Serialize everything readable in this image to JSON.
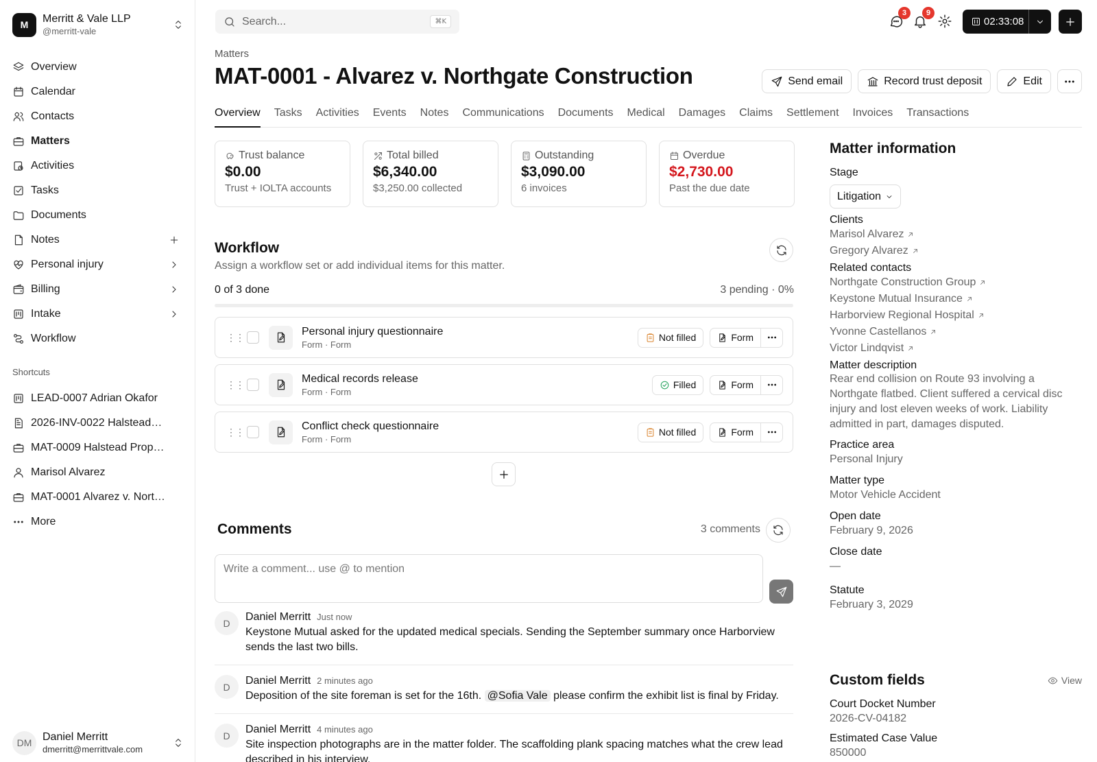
{
  "org": {
    "initial": "M",
    "name": "Merritt & Vale LLP",
    "handle": "@merritt-vale"
  },
  "nav": [
    {
      "label": "Overview",
      "icon": "layers-icon"
    },
    {
      "label": "Calendar",
      "icon": "calendar-icon"
    },
    {
      "label": "Contacts",
      "icon": "users-icon"
    },
    {
      "label": "Matters",
      "icon": "briefcase-icon",
      "active": true
    },
    {
      "label": "Activities",
      "icon": "activity-icon"
    },
    {
      "label": "Tasks",
      "icon": "task-icon"
    },
    {
      "label": "Documents",
      "icon": "folder-icon"
    },
    {
      "label": "Notes",
      "icon": "note-icon",
      "trailing": "plus-icon"
    },
    {
      "label": "Personal injury",
      "icon": "heart-pulse-icon",
      "trailing": "chevron-right-icon"
    },
    {
      "label": "Billing",
      "icon": "wallet-icon",
      "trailing": "chevron-right-icon"
    },
    {
      "label": "Intake",
      "icon": "intake-icon",
      "trailing": "chevron-right-icon"
    },
    {
      "label": "Workflow",
      "icon": "workflow-icon"
    }
  ],
  "shortcuts_title": "Shortcuts",
  "shortcuts": [
    {
      "label": "LEAD-0007 Adrian Okafor",
      "icon": "intake-icon"
    },
    {
      "label": "2026-INV-0022 Halstead…",
      "icon": "invoice-icon"
    },
    {
      "label": "MAT-0009 Halstead Prop…",
      "icon": "briefcase-icon"
    },
    {
      "label": "Marisol Alvarez",
      "icon": "user-icon"
    },
    {
      "label": "MAT-0001 Alvarez v. Nort…",
      "icon": "briefcase-icon"
    },
    {
      "label": "More",
      "icon": "more-icon"
    }
  ],
  "user": {
    "initials": "DM",
    "name": "Daniel Merritt",
    "email": "dmerritt@merrittvale.com"
  },
  "search": {
    "placeholder": "Search...",
    "shortcut": "⌘K"
  },
  "topbar": {
    "messages_count": "3",
    "notifications_count": "9",
    "timer": "02:33:08"
  },
  "header": {
    "breadcrumb": "Matters",
    "title": "MAT-0001 - Alvarez v. Northgate Construction",
    "send_email": "Send email",
    "record_deposit": "Record trust deposit",
    "edit": "Edit"
  },
  "tabs": [
    "Overview",
    "Tasks",
    "Activities",
    "Events",
    "Notes",
    "Communications",
    "Documents",
    "Medical",
    "Damages",
    "Claims",
    "Settlement",
    "Invoices",
    "Transactions"
  ],
  "stats": [
    {
      "label": "Trust balance",
      "value": "$0.00",
      "sub": "Trust + IOLTA accounts",
      "icon": "piggy-bank-icon"
    },
    {
      "label": "Total billed",
      "value": "$6,340.00",
      "sub": "$3,250.00 collected",
      "icon": "receipt-icon"
    },
    {
      "label": "Outstanding",
      "value": "$3,090.00",
      "sub": "6 invoices",
      "icon": "calculator-icon"
    },
    {
      "label": "Overdue",
      "value": "$2,730.00",
      "sub": "Past the due date",
      "icon": "calendar-alert-icon",
      "alert": true
    }
  ],
  "colors": {
    "overdue": "#d4161c",
    "badge": "#e5372d"
  },
  "workflow": {
    "title": "Workflow",
    "subtitle": "Assign a workflow set or add individual items for this matter.",
    "done": "0 of 3 done",
    "pending": "3 pending · 0%",
    "progress": 0,
    "items": [
      {
        "name": "Personal injury questionnaire",
        "meta": "Form · Form",
        "status": "Not filled",
        "filled": false,
        "action": "Form"
      },
      {
        "name": "Medical records release",
        "meta": "Form · Form",
        "status": "Filled",
        "filled": true,
        "action": "Form"
      },
      {
        "name": "Conflict check questionnaire",
        "meta": "Form · Form",
        "status": "Not filled",
        "filled": false,
        "action": "Form"
      }
    ]
  },
  "comments": {
    "title": "Comments",
    "count": "3 comments",
    "placeholder": "Write a comment... use @ to mention",
    "items": [
      {
        "initial": "D",
        "author": "Daniel Merritt",
        "time": "Just now",
        "text": "Keystone Mutual asked for the updated medical specials. Sending the September summary once Harborview sends the last two bills."
      },
      {
        "initial": "D",
        "author": "Daniel Merritt",
        "time": "2 minutes ago",
        "text_before": "Deposition of the site foreman is set for the 16th.",
        "mention": "@Sofia Vale",
        "text_after": "please confirm the exhibit list is final by Friday."
      },
      {
        "initial": "D",
        "author": "Daniel Merritt",
        "time": "4 minutes ago",
        "text": "Site inspection photographs are in the matter folder. The scaffolding plank spacing matches what the crew lead described in his interview."
      }
    ]
  },
  "info": {
    "title": "Matter information",
    "stage_label": "Stage",
    "stage": "Litigation",
    "clients_label": "Clients",
    "clients": [
      "Marisol Alvarez",
      "Gregory Alvarez"
    ],
    "related_label": "Related contacts",
    "related": [
      "Northgate Construction Group",
      "Keystone Mutual Insurance",
      "Harborview Regional Hospital",
      "Yvonne Castellanos",
      "Victor Lindqvist"
    ],
    "description_label": "Matter description",
    "description": "Rear end collision on Route 93 involving a Northgate flatbed. Client suffered a cervical disc injury and lost eleven weeks of work. Liability admitted in part, damages disputed.",
    "practice_label": "Practice area",
    "practice": "Personal Injury",
    "type_label": "Matter type",
    "type": "Motor Vehicle Accident",
    "open_label": "Open date",
    "open": "February 9, 2026",
    "close_label": "Close date",
    "close": "—",
    "statute_label": "Statute",
    "statute": "February 3, 2029"
  },
  "custom_fields": {
    "title": "Custom fields",
    "view": "View",
    "items": [
      {
        "label": "Court Docket Number",
        "value": "2026-CV-04182"
      },
      {
        "label": "Estimated Case Value",
        "value": "850000"
      }
    ]
  }
}
